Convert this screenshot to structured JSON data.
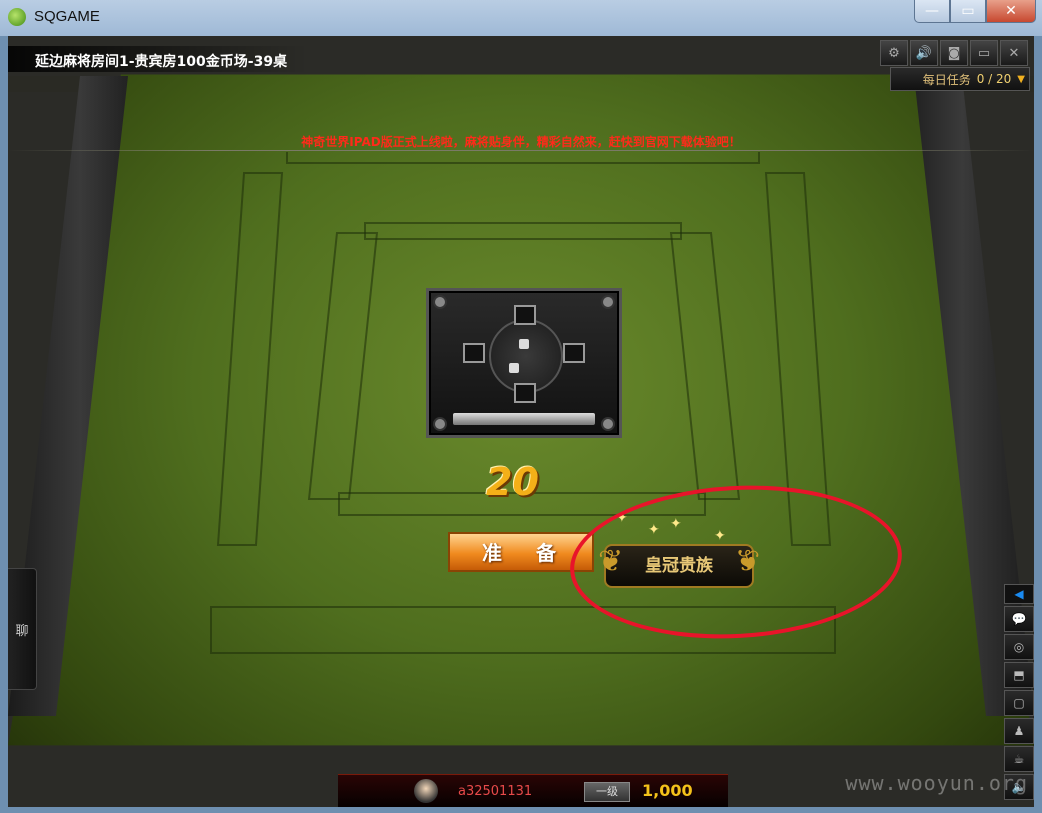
{
  "window": {
    "title": "SQGAME",
    "minimize": "—",
    "maximize": "▭",
    "close": "✕"
  },
  "room": {
    "title": "延边麻将房间1-贵宾房100金币场-39桌"
  },
  "top_icons": [
    "gear-icon",
    "speaker-icon",
    "camera-icon",
    "window-icon",
    "close-icon"
  ],
  "top_icon_glyphs": [
    "⚙",
    "🔊",
    "◙",
    "▭",
    "✕"
  ],
  "tasks": {
    "label": "每日任务",
    "count": "0 / 20",
    "arrow": "▼"
  },
  "banner": "神奇世界IPAD版正式上线啦，麻将贴身伴，精彩自然来，赶快到官网下载体验吧！",
  "countdown": "20",
  "ready_button": "准备",
  "vip_badge": "皇冠贵族",
  "chat_tab": "聊",
  "right_toolbar": {
    "expand": "◀",
    "items": [
      {
        "name": "chat-bubble-icon",
        "glyph": "💬"
      },
      {
        "name": "token-icon",
        "glyph": "◎"
      },
      {
        "name": "table-icon",
        "glyph": "⬒"
      },
      {
        "name": "frame-icon",
        "glyph": "▢"
      },
      {
        "name": "add-friend-icon",
        "glyph": "♟"
      },
      {
        "name": "tea-icon",
        "glyph": "☕"
      },
      {
        "name": "volume-icon",
        "glyph": "🔈"
      }
    ]
  },
  "player": {
    "name": "a32501131",
    "level": "一级",
    "coins": "1,000"
  },
  "watermark": "www.wooyun.org",
  "colors": {
    "felt": "#4f6e1e",
    "banner_red": "#ff2a1a",
    "gold": "#f4b018",
    "annotation_red": "#e8142a"
  }
}
